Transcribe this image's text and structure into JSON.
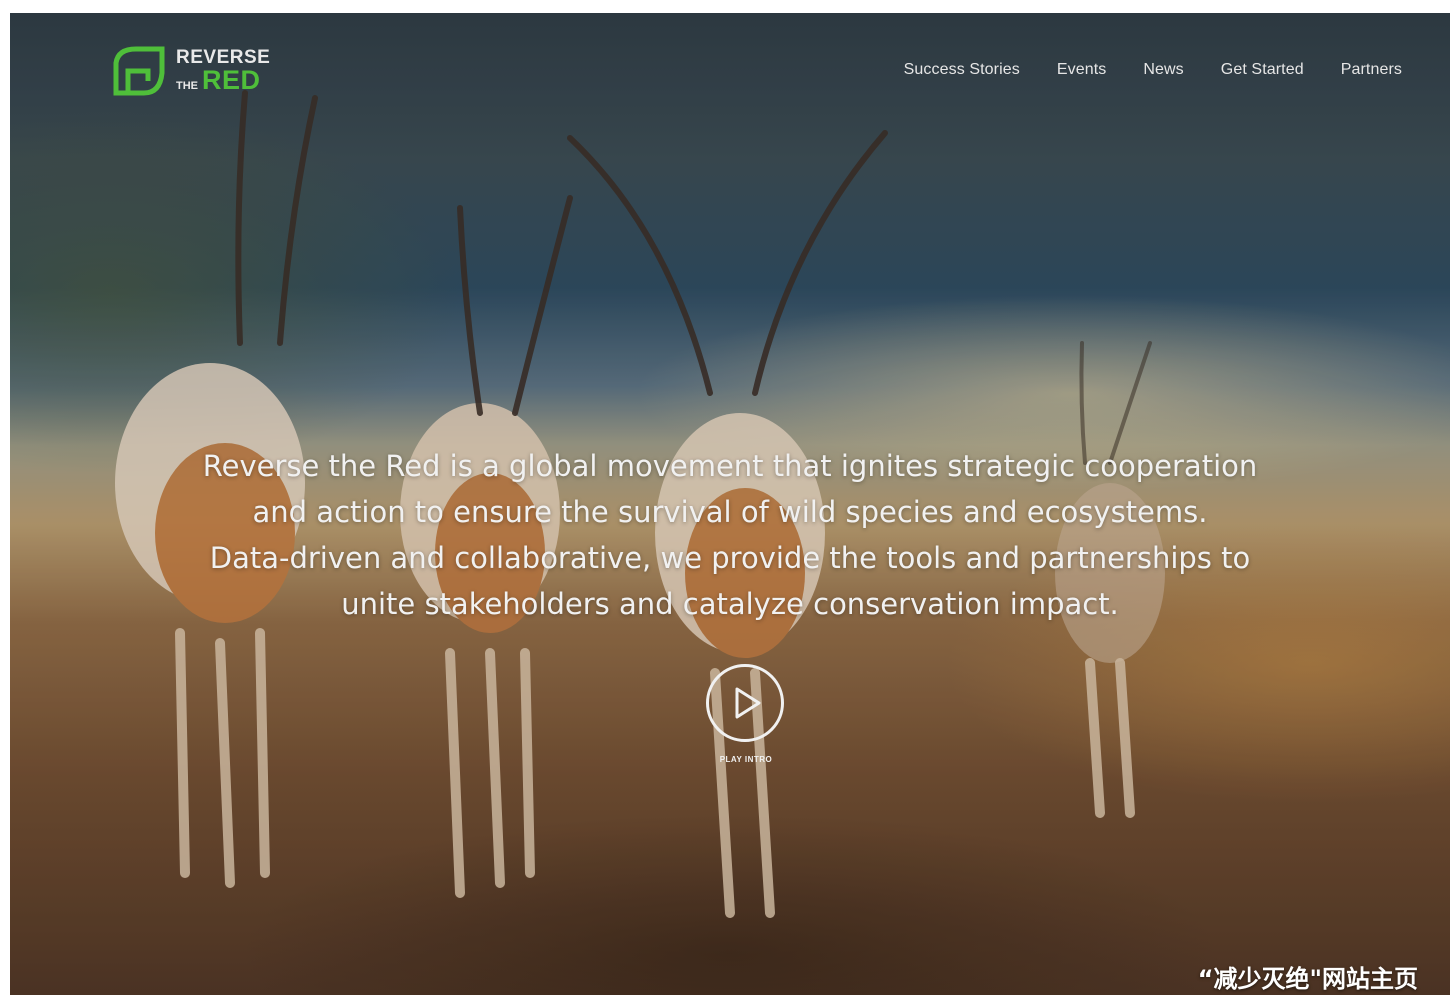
{
  "brand": {
    "name_line1": "REVERSE",
    "name_the": "THE",
    "name_red": "RED",
    "accent_color": "#4fbf3a",
    "icon": "leaf-logo-icon"
  },
  "nav": {
    "items": [
      {
        "label": "Success Stories"
      },
      {
        "label": "Events"
      },
      {
        "label": "News"
      },
      {
        "label": "Get Started"
      },
      {
        "label": "Partners"
      }
    ]
  },
  "hero": {
    "lines": [
      "Reverse the Red is a global movement that ignites strategic cooperation",
      "and action to ensure the survival of wild species and ecosystems.",
      "Data-driven and collaborative, we provide the tools and partnerships to",
      "unite stakeholders and catalyze conservation impact."
    ]
  },
  "play": {
    "label": "PLAY INTRO",
    "icon": "play-icon"
  },
  "caption": {
    "text": "“减少灭绝\"网站主页"
  }
}
